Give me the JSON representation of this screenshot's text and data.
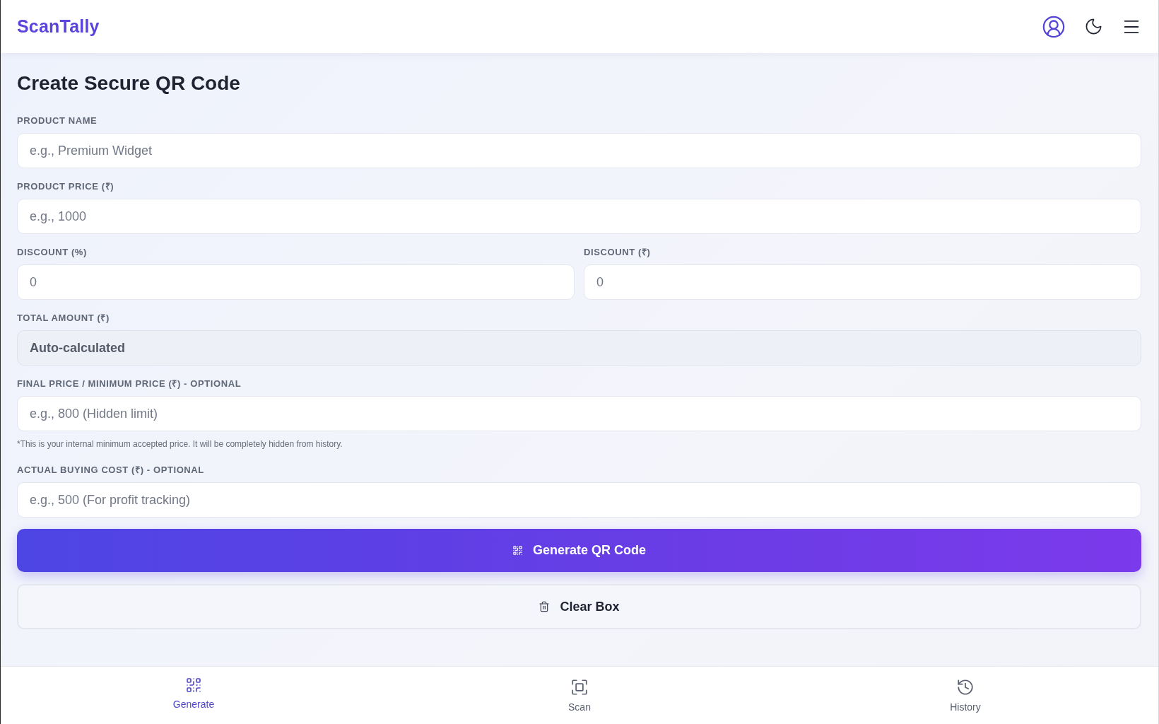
{
  "header": {
    "logo": "ScanTally"
  },
  "page": {
    "title": "Create Secure QR Code"
  },
  "form": {
    "rows": [
      {
        "fields": [
          {
            "kind": "input",
            "label": "PRODUCT NAME",
            "placeholder": "e.g., Premium Widget"
          }
        ]
      },
      {
        "fields": [
          {
            "kind": "input",
            "label": "PRODUCT PRICE (₹)",
            "placeholder": "e.g., 1000"
          }
        ]
      },
      {
        "fields": [
          {
            "kind": "input",
            "label": "DISCOUNT (%)",
            "placeholder": "0"
          },
          {
            "kind": "input",
            "label": "DISCOUNT (₹)",
            "placeholder": "0"
          }
        ]
      },
      {
        "fields": [
          {
            "kind": "readonly",
            "label": "TOTAL AMOUNT (₹)",
            "placeholder": "Auto-calculated"
          }
        ]
      },
      {
        "fields": [
          {
            "kind": "input",
            "label": "FINAL PRICE / MINIMUM PRICE (₹) - OPTIONAL",
            "placeholder": "e.g., 800 (Hidden limit)",
            "note": "*This is your internal minimum accepted price. It will be completely hidden from history."
          }
        ]
      },
      {
        "fields": [
          {
            "kind": "input",
            "label": "ACTUAL BUYING COST (₹) - OPTIONAL",
            "placeholder": "e.g., 500 (For profit tracking)"
          }
        ]
      }
    ]
  },
  "actions": [
    {
      "kind": "primary",
      "label": "Generate QR Code"
    },
    {
      "kind": "secondary",
      "label": "Clear Box"
    }
  ],
  "nav": [
    {
      "label": "Generate",
      "selected": true
    },
    {
      "label": "Scan",
      "selected": false
    },
    {
      "label": "History",
      "selected": false
    }
  ]
}
